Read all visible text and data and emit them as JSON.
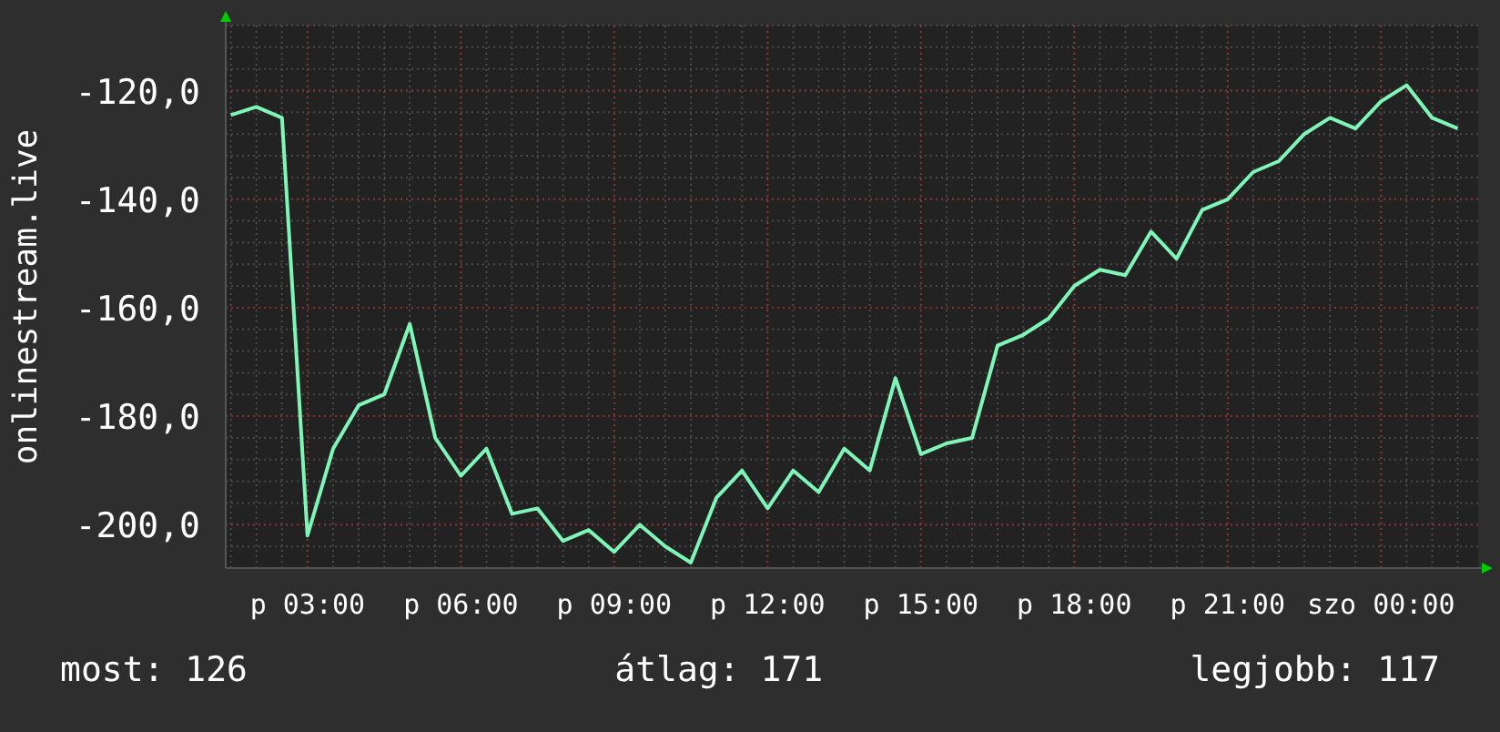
{
  "chart": {
    "chart_data": {
      "type": "line",
      "grid": true,
      "ylabel": "onlinestream.live",
      "categories": [
        null,
        null,
        null,
        "p 03:00",
        null,
        null,
        null,
        null,
        null,
        "p 06:00",
        null,
        null,
        null,
        null,
        null,
        "p 09:00",
        null,
        null,
        null,
        null,
        null,
        "p 12:00",
        null,
        null,
        null,
        null,
        null,
        "p 15:00",
        null,
        null,
        null,
        null,
        null,
        "p 18:00",
        null,
        null,
        null,
        null,
        null,
        "p 21:00",
        null,
        null,
        null,
        null,
        null,
        "szo 00:00",
        null,
        null,
        null
      ],
      "series": [
        {
          "color": "#7ff5b8",
          "values": [
            -124.5,
            -123,
            -125,
            -202,
            -186,
            -178,
            -176,
            -163,
            -184,
            -191,
            -186,
            -198,
            -197,
            -203,
            -201,
            -205,
            -200,
            -204,
            -207,
            -195,
            -190,
            -197,
            -190,
            -194,
            -186,
            -190,
            -173,
            -187,
            -185,
            -184,
            -167,
            -165,
            -162,
            -156,
            -153,
            -154,
            -146,
            -151,
            -142,
            -140,
            -135,
            -133,
            -128,
            -125,
            -127,
            -122,
            -119,
            -125,
            -127
          ]
        }
      ],
      "ylim": [
        -208,
        -108
      ],
      "yticks": [
        {
          "value": -120,
          "label": "-120,0"
        },
        {
          "value": -140,
          "label": "-140,0"
        },
        {
          "value": -160,
          "label": "-160,0"
        },
        {
          "value": -180,
          "label": "-180,0"
        },
        {
          "value": -200,
          "label": "-200,0"
        }
      ]
    }
  },
  "legend": [
    {
      "label": "most:",
      "value": "126"
    },
    {
      "label": "átlag:",
      "value": "171"
    },
    {
      "label": "legjobb:",
      "value": "117"
    }
  ]
}
